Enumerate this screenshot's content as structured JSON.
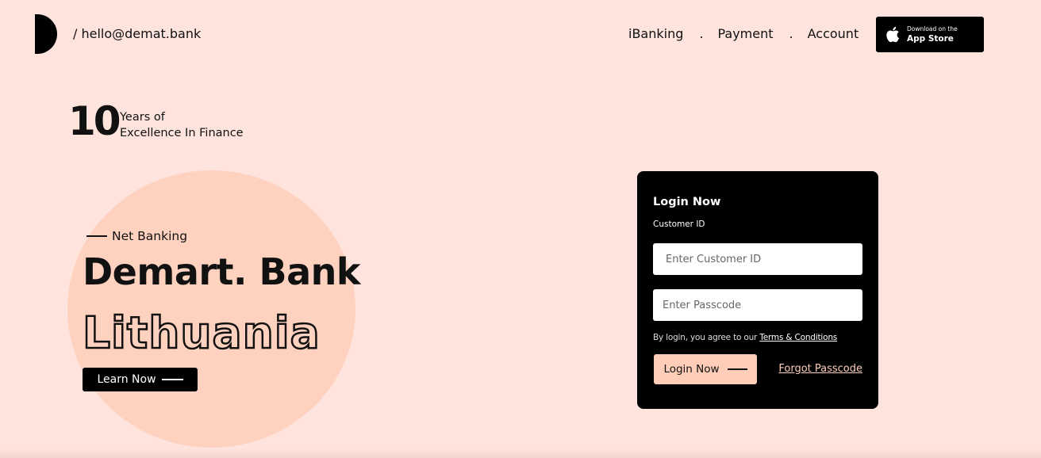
{
  "header": {
    "email": "/ hello@demat.bank",
    "nav": [
      {
        "label": "iBanking"
      },
      {
        "label": "Payment"
      },
      {
        "label": "Account"
      }
    ],
    "separator": ".",
    "app_store": {
      "small": "Download on the",
      "big": "App Store",
      "icon": "apple-icon"
    }
  },
  "badge": {
    "number": "10",
    "line1": "Years of",
    "line2": "Excellence In Finance"
  },
  "hero": {
    "eyebrow": "Net Banking",
    "title": "Demart. Bank",
    "outline_title": "Lithuania",
    "cta": "Learn Now"
  },
  "login": {
    "title": "Login Now",
    "customer_label": "Customer ID",
    "customer_placeholder": "Enter Customer ID",
    "passcode_placeholder": "Enter Passcode",
    "agree_text": "By login, you agree to our ",
    "terms_link": "Terms & Conditions",
    "submit": "Login Now",
    "forgot": "Forgot Passcode"
  },
  "colors": {
    "background": "#ffe3dd",
    "accent": "#ffcdb8",
    "circle": "#ffd1bf",
    "dark": "#000000"
  }
}
